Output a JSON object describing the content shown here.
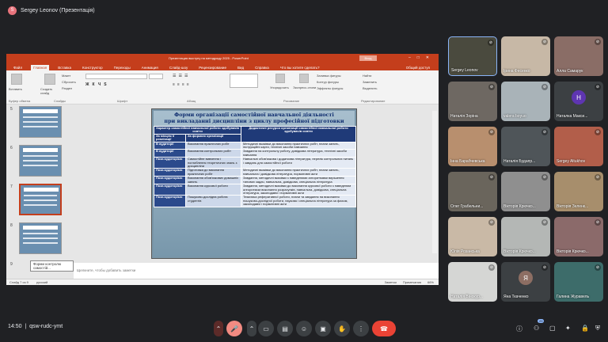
{
  "presenter": {
    "initial": "S",
    "label": "Sergey Leonov (Презентація)"
  },
  "ppt": {
    "title": "Презентация выступу на методраду 2025  -  PowerPoint",
    "signin": "Вход",
    "tabs": [
      "Файл",
      "Главная",
      "Вставка",
      "Конструктор",
      "Переходы",
      "Анимация",
      "Слайд-шоу",
      "Рецензирование",
      "Вид",
      "Справка",
      "Что вы хотите сделать?"
    ],
    "share": "Общий доступ",
    "groups": [
      "Буфер обмена",
      "Слайды",
      "Шрифт",
      "Абзац",
      "Рисование",
      "Редактирование"
    ],
    "ribbon_items": {
      "paste": "Вставить",
      "create": "Создать слайд",
      "layout": "Макет",
      "reset": "Сбросить",
      "section": "Раздел",
      "arrange": "Упорядочить",
      "styles": "Экспресс-стили",
      "fill": "Заливка фигуры",
      "outline": "Контур фигуры",
      "effects": "Эффекты фигуры",
      "find": "Найти",
      "replace": "Заменить",
      "select": "Выделить"
    },
    "slide_numbers": [
      "5",
      "6",
      "7",
      "8",
      "9"
    ],
    "tooltip": "Форми контролю самостій...",
    "notes_placeholder": "Щелкните, чтобы добавить заметки",
    "status": {
      "slide": "Слайд 7 из 9",
      "lang": "русский",
      "notes": "Заметки",
      "comments": "Примечания",
      "zoom": "66%"
    }
  },
  "slide": {
    "title1": "Форми організації самостійної навчальної діяльності",
    "title2": "при викладанні дисципліни з циклу професійної підготовки",
    "col1": "Характер самостійної навчальної роботи здобувачів освіти",
    "col2": "Дидактичні ресурси організації самостійної навчальної роботи здобувачів освіти",
    "sub1": "За місцем її реалізації",
    "sub2": "За формою організації",
    "rows": [
      {
        "a": "В аудиторії",
        "b": "Виконання практичних робіт",
        "c": "Методичні вказівки до виконання практичних робіт, плани занять, інструкційні карти, технічні засоби навчання"
      },
      {
        "a": "В аудиторії",
        "b": "Виконання контрольних робіт",
        "c": "Завдання на контрольну роботу, довідкова література, технічні засоби навчання"
      },
      {
        "a": "Поза аудиторією",
        "b": "Самостійне вивчення і поглиблення теоретичних знань з дисципліни",
        "c": "Навчальні обов'язкова і додаткова література, перелік контрольних питань і завдань для самостійної роботи"
      },
      {
        "a": "Поза аудиторією",
        "b": "Підготовка до виконання практичних робіт",
        "c": "Методичні вказівки до виконання практичних робіт, плани занять, навчальна і довідкова література, нормативні акти"
      },
      {
        "a": "Поза аудиторією",
        "b": "Виконання обов'язкових домашніх занять",
        "c": "Завдання, методичні вказівки з наведеними алгоритмами вирішення типових задач, навчальна, довідкова, спеціальна література"
      },
      {
        "a": "Поза аудиторією",
        "b": "Виконання курсової роботи",
        "c": "Завдання, методичні вказівки до виконання курсової роботи з наведеним алгоритмом виконання розрахунків, навчальна, довідкова, спеціальна література, законодавчі і нормативні акти"
      },
      {
        "a": "Поза аудиторією",
        "b": "Пошуково-дослідна робота студентів",
        "c": "Тематика реферативної роботи, плани та завдання на виконання пошуково-дослідної роботи, наукова і спеціальна література за фахом, законодавчі і нормативні акти"
      }
    ]
  },
  "participants": [
    {
      "name": "Sergey Leonov",
      "bg": "#4a4a3e",
      "speaking": true
    },
    {
      "name": "Ірина Фесенко",
      "bg": "#c7b8a6"
    },
    {
      "name": "Алла Самарук",
      "bg": "#8a6d66"
    },
    {
      "name": "Наталія Зоріна",
      "bg": "#6e6862"
    },
    {
      "name": "valera boyuo",
      "bg": "#a9b3b8"
    },
    {
      "name": "Наталка Макси...",
      "bg": "#3c4043",
      "initial": "H",
      "ini_bg": "#5e35b1"
    },
    {
      "name": "Інна Барабчевська",
      "bg": "#b88f6e"
    },
    {
      "name": "Наталія Будапр...",
      "bg": "#4f5559",
      "initial_icon": true
    },
    {
      "name": "Sergey Altukhov",
      "bg": "#b25e4a"
    },
    {
      "name": "Олег Грабельни...",
      "bg": "#6a655c"
    },
    {
      "name": "Вікторія Крючко...",
      "bg": "#8f8f8f"
    },
    {
      "name": "Вікторія Зеленк...",
      "bg": "#a78e6c"
    },
    {
      "name": "Юлія Розанська",
      "bg": "#c9b9a6"
    },
    {
      "name": "Вікторія Крючко...",
      "bg": "#b4b7b5"
    },
    {
      "name": "Вікторія Крючко...",
      "bg": "#8b6a6a"
    },
    {
      "name": "Наталія Вінокур...",
      "bg": "#d5d6d4"
    },
    {
      "name": "Яна Ткаченко",
      "bg": "#3c4043",
      "initial": "Я",
      "ini_bg": "#8d6e63"
    },
    {
      "name": "Галина Журавель",
      "bg": "#3d6c6a"
    }
  ],
  "bottom": {
    "time": "14:50",
    "code": "qsw-rudc-ymt",
    "participants_count": "29"
  }
}
